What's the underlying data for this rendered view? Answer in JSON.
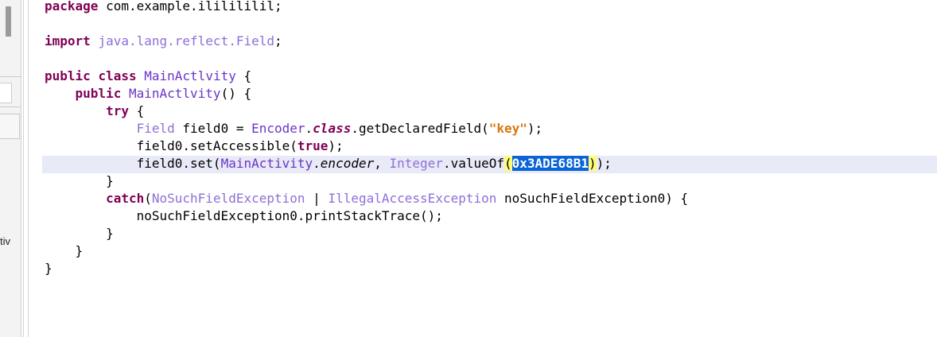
{
  "left_panel": {
    "clipped_label": "tiv"
  },
  "code": {
    "line_1": {
      "kw": "package",
      "rest": " com.example.ililililil;"
    },
    "line_3": {
      "kw": "import",
      "type": "java.lang.reflect.Field",
      "rest": ";"
    },
    "line_5": {
      "kw1": "public",
      "kw2": "class",
      "cls": "MainActlvity",
      "rest": " {"
    },
    "line_6": {
      "kw": "public",
      "cls": "MainActlvity",
      "rest": "() {"
    },
    "line_7": {
      "kw": "try",
      "rest": " {"
    },
    "line_8": {
      "type": "Field",
      "mid1": " field0 = ",
      "cls": "Encoder",
      "dot": ".",
      "kw_it": "class",
      "mid2": ".getDeclaredField(",
      "str": "\"key\"",
      "rest": ");"
    },
    "line_9": {
      "pre": "field0.setAccessible(",
      "kw": "true",
      "rest": ");"
    },
    "line_10": {
      "pre": "field0.set(",
      "cls": "MainActivity",
      "dot": ".",
      "field_it": "encoder",
      "mid": ", ",
      "type": "Integer",
      "mid2": ".valueOf",
      "open": "(",
      "hex": "0x3ADE68B1",
      "close": ")",
      "rest": ");"
    },
    "line_11": {
      "text": "}"
    },
    "line_12": {
      "kw": "catch",
      "open": "(",
      "type1": "NoSuchFieldException",
      "sep": " | ",
      "type2": "IllegalAccessException",
      "rest": " noSuchFieldException0) {"
    },
    "line_13": {
      "text": "noSuchFieldException0.printStackTrace();"
    },
    "line_14": {
      "text": "}"
    },
    "line_15": {
      "text": "}"
    },
    "line_16": {
      "text": "}"
    }
  }
}
